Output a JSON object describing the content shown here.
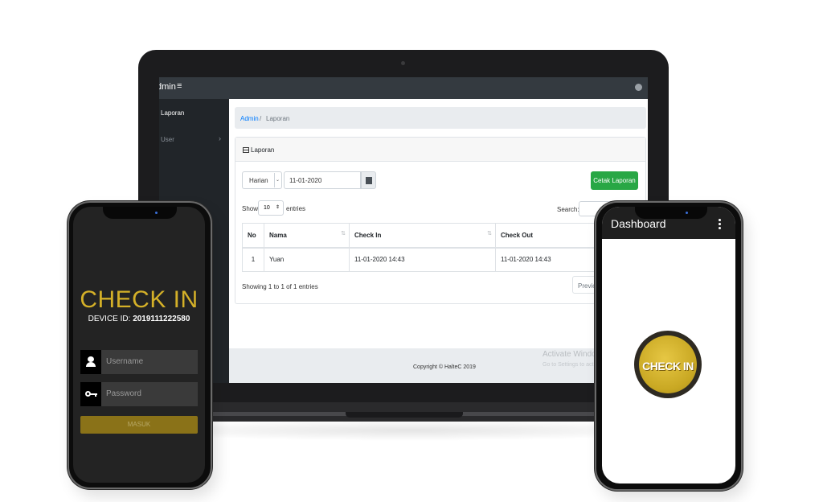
{
  "laptop": {
    "brand": "dmin",
    "menu_icon": "hamburger-icon",
    "user_icon": "user-circle-icon",
    "sidebar": {
      "items": [
        {
          "label": "Laporan"
        },
        {
          "label": "User"
        }
      ]
    },
    "breadcrumb": {
      "root": "Admin",
      "separator": "/",
      "current": "Laporan"
    },
    "card": {
      "title": "Laporan",
      "period_select": "Harian",
      "date_value": "11-01-2020",
      "print_button": "Cetak Laporan",
      "show_label": "Show",
      "page_length": "10",
      "entries_label": "entries",
      "search_label": "Search:",
      "columns": [
        "No",
        "Nama",
        "Check In",
        "Check Out"
      ],
      "rows": [
        {
          "no": "1",
          "nama": "Yuan",
          "check_in": "11-01-2020 14:43",
          "check_out": "11-01-2020 14:43"
        }
      ],
      "info": "Showing 1 to 1 of 1 entries",
      "prev_button": "Previo"
    },
    "footer": {
      "copyright": "Copyright © HalteC 2019"
    },
    "watermark": {
      "title": "Activate Windo",
      "sub": "Go to Settings to act"
    }
  },
  "phone_left": {
    "title": "CHECK IN",
    "device_label": "DEVICE ID:",
    "device_id": "2019111222580",
    "username_placeholder": "Username",
    "password_placeholder": "Password",
    "submit_button": "MASUK",
    "accent": "#d4b028"
  },
  "phone_right": {
    "header_title": "Dashboard",
    "button_label": "CHECK IN",
    "button_color": "#c9a823"
  }
}
